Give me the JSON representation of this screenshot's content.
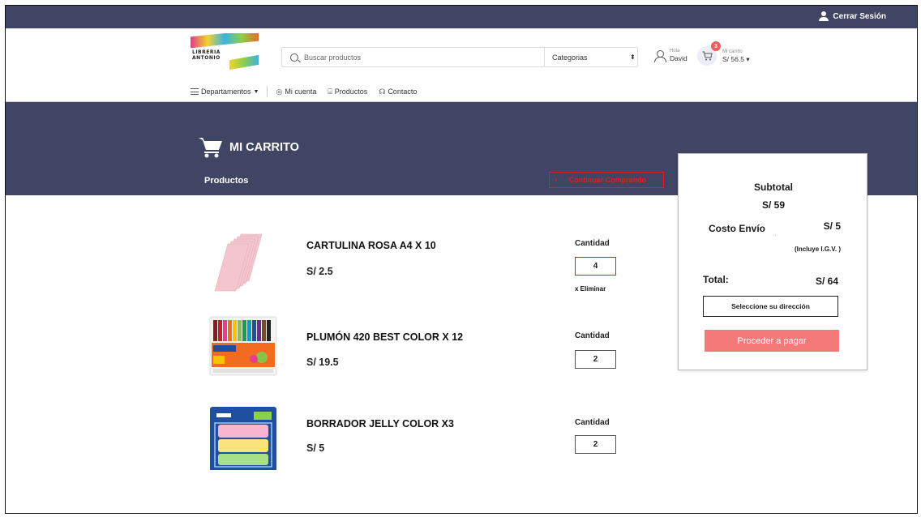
{
  "topbar": {
    "logout_label": "Cerrar Sesión"
  },
  "logo": {
    "line1": "LIBRERIA",
    "line2": "ANTONIO"
  },
  "search": {
    "placeholder": "Buscar productos",
    "category_label": "Categorias"
  },
  "account": {
    "greeting": "Hola",
    "user_name": "David"
  },
  "cart_mini": {
    "label": "Mi carrito",
    "total": "S/ 56.5",
    "badge_count": "3"
  },
  "nav": {
    "departments": "Departamentos",
    "my_account": "Mi cuenta",
    "products": "Productos",
    "contact": "Contacto"
  },
  "page": {
    "title": "MI CARRITO",
    "products_heading": "Productos",
    "continue_label": "Continuar Comprando"
  },
  "items": [
    {
      "name": "CARTULINA ROSA A4 X 10",
      "price": "S/ 2.5",
      "qty_label": "Cantidad",
      "qty": "4",
      "remove_label": "x Eliminar"
    },
    {
      "name": "PLUMÓN 420 BEST COLOR X 12",
      "price": "S/ 19.5",
      "qty_label": "Cantidad",
      "qty": "2"
    },
    {
      "name": "BORRADOR JELLY COLOR X3",
      "price": "S/ 5",
      "qty_label": "Cantidad",
      "qty": "2"
    }
  ],
  "summary": {
    "subtotal_label": "Subtotal",
    "subtotal_value": "S/ 59",
    "shipping_label": "Costo Envío",
    "shipping_value": "S/ 5",
    "tax_note": "(Incluye I.G.V. )",
    "total_label": "Total:",
    "total_value": "S/ 64",
    "address_button": "Seleccione su dirección",
    "pay_button": "Proceder a pagar"
  },
  "colors": {
    "header_bg": "#3f4563",
    "accent_red": "#e41b23",
    "pay_button_bg": "#f47a7a"
  }
}
